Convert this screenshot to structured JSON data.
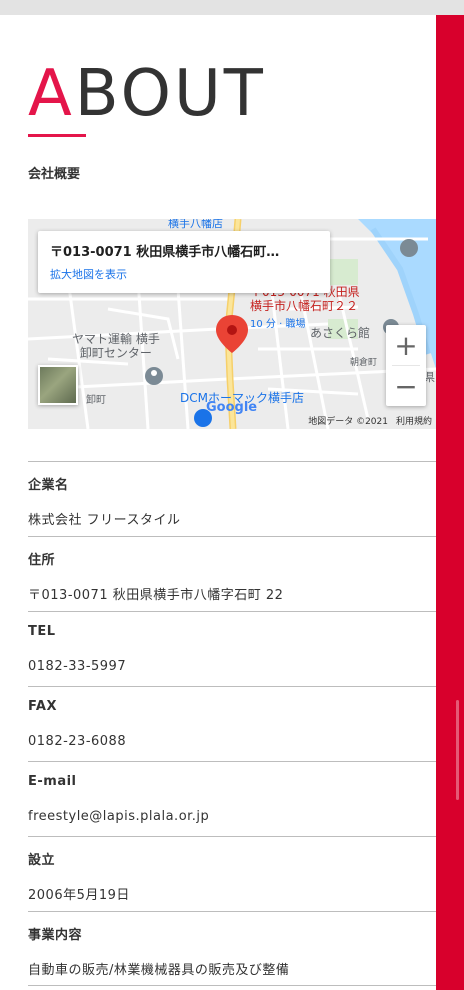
{
  "heading": {
    "first_letter": "A",
    "rest": "BOUT"
  },
  "subheading": "会社概要",
  "map": {
    "card_title": "〒013-0071 秋田県横手市八幡石町…",
    "card_link": "拡大地図を表示",
    "labels": {
      "pin_label_1": "〒013-0071 秋田県",
      "pin_label_2": "横手市八幡石町２２",
      "transit": "10 分 · 職場",
      "yamato_1": "ヤマト運輸 横手",
      "yamato_2": "卸町センター",
      "asakura": "あさくら館",
      "asakura_station": "朝倉町",
      "dcm": "DCMホーマック横手店",
      "oroshi": "卸町",
      "top_store": "横手八幡店",
      "ken": "県"
    },
    "zoom_in": "+",
    "zoom_out": "−",
    "google": "Google",
    "footer_data": "地図データ ©2021",
    "footer_terms": "利用規約"
  },
  "rows": [
    {
      "label": "企業名",
      "value": "株式会社 フリースタイル"
    },
    {
      "label": "住所",
      "value": "〒013-0071 秋田県横手市八幡字石町 22"
    },
    {
      "label": "TEL",
      "value": "0182-33-5997"
    },
    {
      "label": "FAX",
      "value": "0182-23-6088"
    },
    {
      "label": "E-mail",
      "value": "freestyle@lapis.plala.or.jp"
    },
    {
      "label": "設立",
      "value": "2006年5月19日"
    },
    {
      "label": "事業内容",
      "value": "自動車の販売/林業機械器具の販売及び整備"
    }
  ],
  "colors": {
    "accent": "#e4154a",
    "sidebar": "#d8002c",
    "map_link": "#1a73e8"
  }
}
